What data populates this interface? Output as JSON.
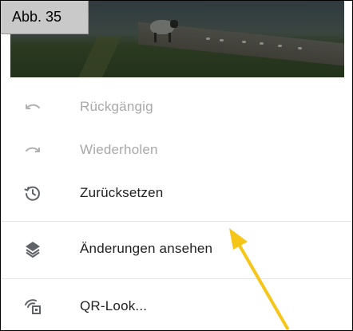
{
  "caption": {
    "text": "Abb. 35"
  },
  "menu": {
    "items": [
      {
        "label": "Rückgängig",
        "icon": "undo-icon",
        "enabled": false
      },
      {
        "label": "Wiederholen",
        "icon": "redo-icon",
        "enabled": false
      },
      {
        "label": "Zurücksetzen",
        "icon": "history-reset-icon",
        "enabled": true
      },
      {
        "label": "Änderungen ansehen",
        "icon": "layers-icon",
        "enabled": true
      },
      {
        "label": "QR-Look...",
        "icon": "qr-look-icon",
        "enabled": true
      }
    ]
  },
  "colors": {
    "annotation_arrow": "#f5c518",
    "disabled_text": "#a8a8a8",
    "enabled_text": "#212121",
    "icon_enabled": "#5f6368",
    "icon_disabled": "#b0b0b0",
    "divider": "#e3e3e3"
  }
}
